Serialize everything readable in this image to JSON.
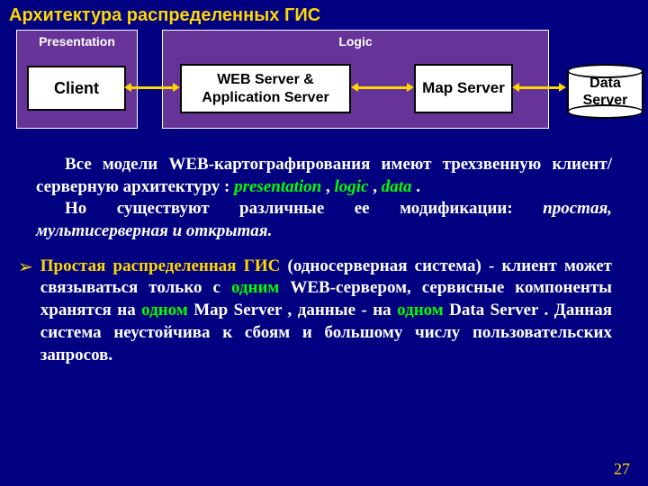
{
  "title": "Архитектура распределенных ГИС",
  "diagram": {
    "presentation_label": "Presentation",
    "logic_label": "Logic",
    "client": "Client",
    "web_server": "WEB Server & Application Server",
    "map_server": "Map Server",
    "data_server": "Data Server"
  },
  "para1": {
    "t1": "Все модели WEB-картографирования имеют трехзвенную клиент/серверную архитектуру : ",
    "presentation": "presentation",
    "sep1": " , ",
    "logic": "logic",
    "sep2": " , ",
    "data": "data",
    "end": " ."
  },
  "para2": {
    "t1": "Но существуют различные ее модификации: ",
    "m1": "простая, мультисерверная и открытая."
  },
  "bullet": {
    "mark": "➢",
    "heading": "Простая распределенная ГИС",
    "t1": " (односерверная система) - клиент может связываться только с ",
    "one1": "одним",
    "t2": " WEB-сервером, сервисные компоненты хранятся на ",
    "one2": "одном",
    "t3": " Map Server , данные - на ",
    "one3": "одном",
    "t4": " Data Server . Данная система неустойчива к сбоям и большому числу пользовательских запросов."
  },
  "page": "27"
}
